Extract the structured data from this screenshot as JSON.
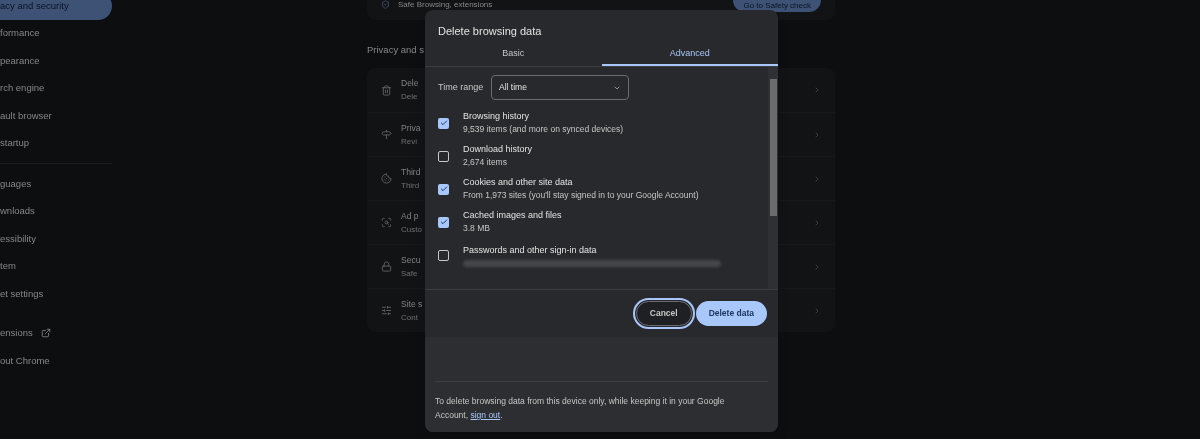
{
  "sidebar": {
    "sections": [
      {
        "items": [
          {
            "label": "acy and security",
            "selected": true,
            "external_link": false
          },
          {
            "label": "formance",
            "selected": false,
            "external_link": false
          },
          {
            "label": "pearance",
            "selected": false,
            "external_link": false
          },
          {
            "label": "rch engine",
            "selected": false,
            "external_link": false
          },
          {
            "label": "ault browser",
            "selected": false,
            "external_link": false
          },
          {
            "label": "startup",
            "selected": false,
            "external_link": false
          }
        ]
      },
      {
        "items": [
          {
            "label": "guages",
            "selected": false,
            "external_link": false
          },
          {
            "label": "wnloads",
            "selected": false,
            "external_link": false
          },
          {
            "label": "essibility",
            "selected": false,
            "external_link": false
          },
          {
            "label": "tem",
            "selected": false,
            "external_link": false
          },
          {
            "label": "et settings",
            "selected": false,
            "external_link": false
          }
        ]
      },
      {
        "items": [
          {
            "label": "ensions",
            "selected": false,
            "external_link": true
          },
          {
            "label": "out Chrome",
            "selected": false,
            "external_link": false
          }
        ]
      }
    ]
  },
  "safety_card": {
    "text": "Safe Browsing, extensions",
    "button": "Go to Safety check"
  },
  "section_heading": "Privacy and s",
  "rows": [
    {
      "kind": "delete",
      "title": "Dele",
      "subtitle": "Dele"
    },
    {
      "kind": "guide",
      "title": "Priva",
      "subtitle": "Revi"
    },
    {
      "kind": "cookies",
      "title": "Third",
      "subtitle": "Third"
    },
    {
      "kind": "ads",
      "title": "Ad p",
      "subtitle": "Custo"
    },
    {
      "kind": "security",
      "title": "Secu",
      "subtitle": "Safe"
    },
    {
      "kind": "site",
      "title": "Site s",
      "subtitle": "Cont"
    }
  ],
  "dialog": {
    "title": "Delete browsing data",
    "tabs": [
      {
        "label": "Basic",
        "selected": false
      },
      {
        "label": "Advanced",
        "selected": true
      }
    ],
    "time_range": {
      "label": "Time range",
      "value": "All time"
    },
    "options": [
      {
        "title": "Browsing history",
        "subtitle": "9,539 items (and more on synced devices)",
        "checked": true,
        "redacted": false
      },
      {
        "title": "Download history",
        "subtitle": "2,674 items",
        "checked": false,
        "redacted": false
      },
      {
        "title": "Cookies and other site data",
        "subtitle": "From 1,973 sites (you'll stay signed in to your Google Account)",
        "checked": true,
        "redacted": false
      },
      {
        "title": "Cached images and files",
        "subtitle": "3.8 MB",
        "checked": true,
        "redacted": false
      },
      {
        "title": "Passwords and other sign-in data",
        "checked": false,
        "redacted": true
      }
    ],
    "buttons": [
      {
        "label": "Cancel",
        "kind": "secondary",
        "focused": true
      },
      {
        "label": "Delete data",
        "kind": "primary",
        "focused": false
      }
    ],
    "footer": {
      "text": "To delete browsing data from this device only, while keeping it in your Google Account, ",
      "link": "sign out",
      "after": "."
    }
  }
}
